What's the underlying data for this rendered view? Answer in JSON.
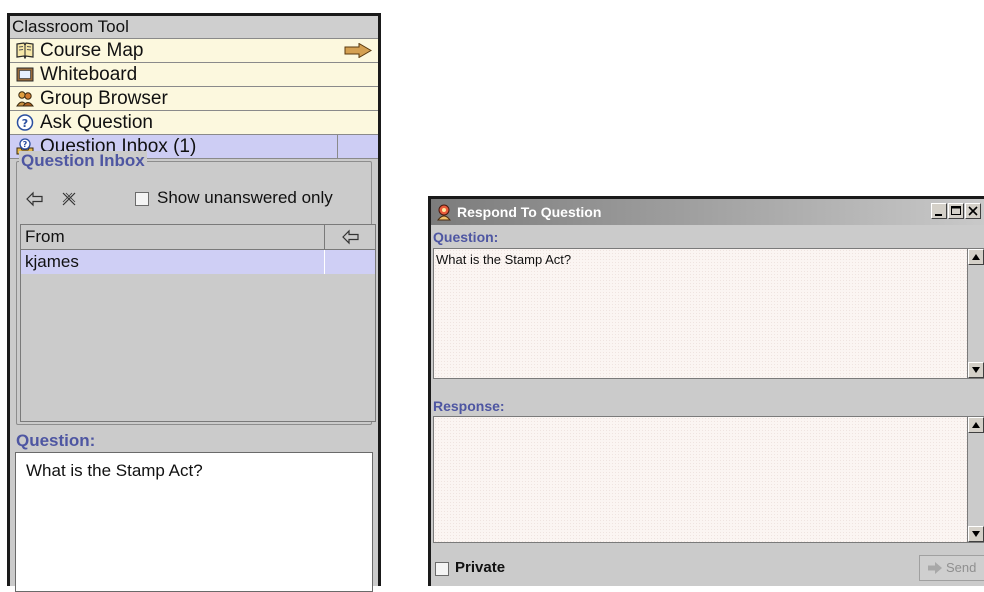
{
  "classroom": {
    "title": "Classroom Tool",
    "nav": [
      {
        "label": "Course Map",
        "icon": "book-icon"
      },
      {
        "label": "Whiteboard",
        "icon": "whiteboard-icon"
      },
      {
        "label": "Group Browser",
        "icon": "group-icon"
      },
      {
        "label": "Ask Question",
        "icon": "question-circle-icon"
      },
      {
        "label": "Question Inbox (1)",
        "icon": "question-inbox-icon",
        "selected": true
      }
    ]
  },
  "inbox": {
    "group_title": "Question Inbox",
    "filter_label": "Show unanswered only",
    "filter_checked": false,
    "table": {
      "header": "From",
      "rows": [
        {
          "from": "kjames"
        }
      ]
    },
    "question_label": "Question:",
    "question_text": "What is the Stamp Act?"
  },
  "respond": {
    "title": "Respond To Question",
    "question_label": "Question:",
    "question_text": "What is the Stamp Act?",
    "response_label": "Response:",
    "response_text": "",
    "private_label": "Private",
    "private_checked": false,
    "send_label": "Send"
  },
  "colors": {
    "panel_bg": "#cbcbcb",
    "nav_bg": "#fcf8de",
    "selected_bg": "#cdcdf4",
    "label_blue": "#4e56a2"
  }
}
